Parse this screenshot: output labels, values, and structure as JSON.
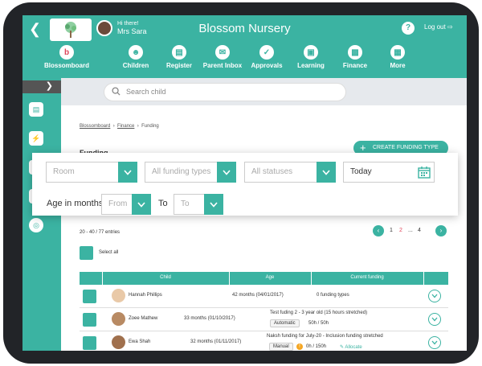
{
  "header": {
    "greeting": "Hi there!",
    "user_name": "Mrs Sara",
    "title": "Blossom Nursery",
    "help": "?",
    "logout": "Log out"
  },
  "nav": [
    {
      "label": "Blossomboard",
      "icon": "blossom-logo-icon"
    },
    {
      "label": "Children",
      "icon": "smiley-icon"
    },
    {
      "label": "Register",
      "icon": "register-icon"
    },
    {
      "label": "Parent Inbox",
      "icon": "inbox-icon"
    },
    {
      "label": "Approvals",
      "icon": "clipboard-check-icon"
    },
    {
      "label": "Learning",
      "icon": "book-icon"
    },
    {
      "label": "Finance",
      "icon": "chart-icon"
    },
    {
      "label": "More",
      "icon": "grid-icon"
    }
  ],
  "search": {
    "placeholder": "Search child"
  },
  "breadcrumb": {
    "home": "Blossomboard",
    "section": "Finance",
    "current": "Funding"
  },
  "page_title": "Funding",
  "create_button": "CREATE FUNDING TYPE",
  "filters": {
    "room": "Room",
    "funding_types": "All funding types",
    "statuses": "All statuses",
    "date": "Today",
    "age_label": "Age in months",
    "from": "From",
    "to_label": "To",
    "to": "To"
  },
  "entries": "20 - 40 / 77 entries",
  "select_all": "Select all",
  "table": {
    "headers": [
      "Child",
      "Age",
      "Current funding"
    ],
    "rows": [
      {
        "name": "Hannah Phillips",
        "age": "42 months (04/01/2017)",
        "funding": "0 funding types",
        "tag": "",
        "hours": "",
        "allocate": ""
      },
      {
        "name": "Zoee Mathew",
        "age": "33 months (01/10/2017)",
        "funding": "Test fuding 2 - 3 year old (15 hours stretched)",
        "tag": "Automatic",
        "hours": "50h / 50h",
        "allocate": ""
      },
      {
        "name": "Ewa Shah",
        "age": "32 months (01/11/2017)",
        "funding": "Naksh funding for July-20 - Inclusion funding stretched",
        "tag": "Manual",
        "hours": "0h / 150h",
        "allocate": "Allocate"
      }
    ]
  },
  "pager": {
    "prev": "‹",
    "pages": [
      "1",
      "2",
      "...",
      "4"
    ],
    "next": "›"
  }
}
